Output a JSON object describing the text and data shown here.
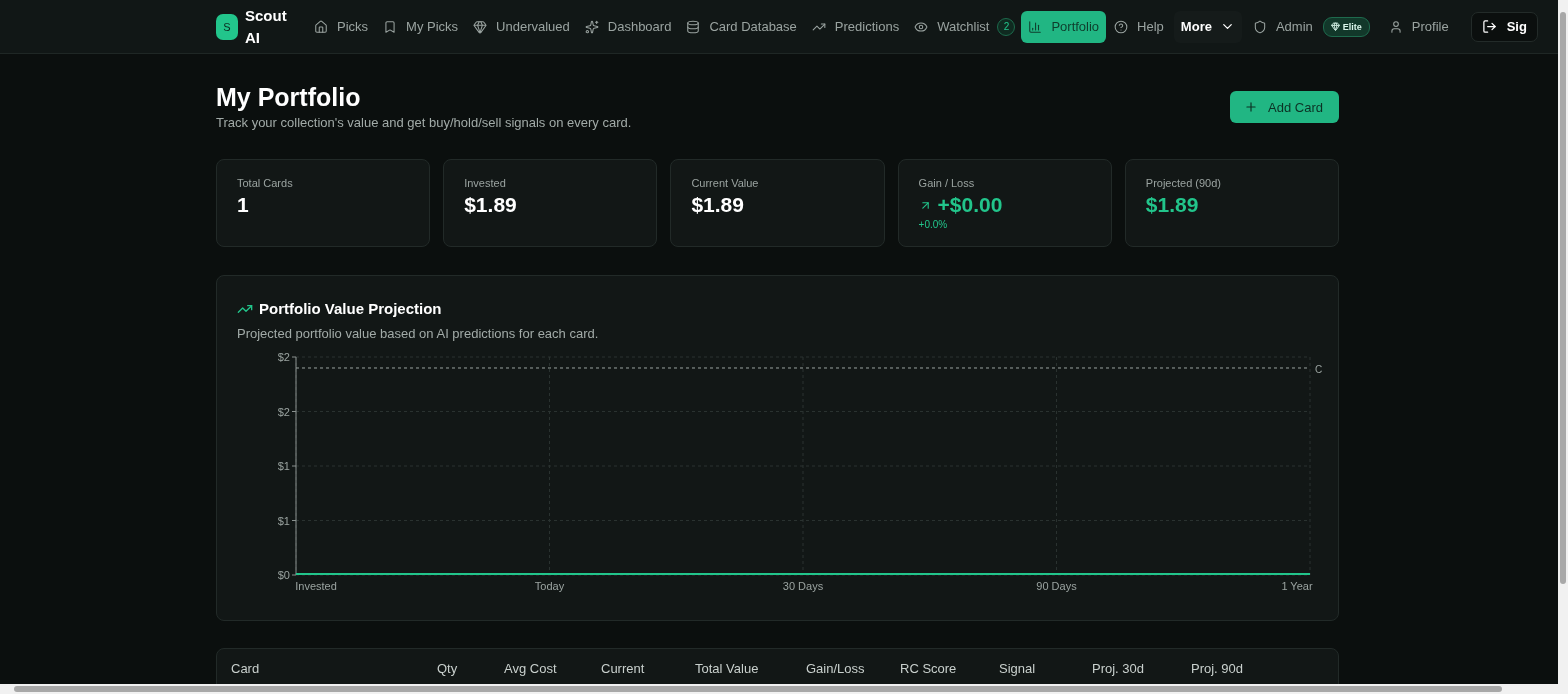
{
  "brand": {
    "mark": "S",
    "name": "Scout AI"
  },
  "nav": [
    {
      "label": "Picks",
      "selected": false
    },
    {
      "label": "My Picks",
      "selected": false
    },
    {
      "label": "Undervalued",
      "selected": false
    },
    {
      "label": "Dashboard",
      "selected": false
    },
    {
      "label": "Card Database",
      "selected": false
    },
    {
      "label": "Predictions",
      "selected": false
    },
    {
      "label": "Watchlist",
      "selected": false,
      "badge": "2"
    },
    {
      "label": "Portfolio",
      "selected": true
    },
    {
      "label": "Help",
      "selected": false
    }
  ],
  "more_menu": {
    "label": "More"
  },
  "admin": {
    "label": "Admin",
    "badge": "Elite"
  },
  "profile": {
    "label": "Profile"
  },
  "sign_out": {
    "label": "Sig"
  },
  "page": {
    "title": "My Portfolio",
    "subtitle": "Track your collection's value and get buy/hold/sell signals on every card.",
    "add_button": "Add Card"
  },
  "stats": [
    {
      "label": "Total Cards",
      "value": "1",
      "positive": false
    },
    {
      "label": "Invested",
      "value": "$1.89",
      "positive": false
    },
    {
      "label": "Current Value",
      "value": "$1.89",
      "positive": false
    },
    {
      "label": "Gain / Loss",
      "value": "+$0.00",
      "positive": true,
      "sub": "+0.0%"
    },
    {
      "label": "Projected (90d)",
      "value": "$1.89",
      "positive": true
    }
  ],
  "projection": {
    "title": "Portfolio Value Projection",
    "description": "Projected portfolio value based on AI predictions for each card.",
    "chart_data": {
      "type": "line",
      "categories": [
        "Invested",
        "Today",
        "30 Days",
        "90 Days",
        "1 Year"
      ],
      "series": [
        {
          "color": "#22c58b",
          "values": [
            0,
            0,
            0,
            0,
            0
          ]
        },
        {
          "color": "#9aa3a0",
          "line_style": "dashed",
          "values": [
            1.89,
            1.89,
            1.89,
            1.89,
            1.89
          ]
        }
      ],
      "grid": true,
      "ylim": [
        0,
        2
      ],
      "yticks": [
        {
          "value": 0,
          "label": "$0"
        },
        {
          "value": 0.5,
          "label": "$1"
        },
        {
          "value": 1,
          "label": "$1"
        },
        {
          "value": 1.5,
          "label": "$2"
        },
        {
          "value": 2,
          "label": "$2"
        }
      ],
      "annotations": [
        {
          "text": "C"
        }
      ]
    }
  },
  "table": {
    "columns": [
      "Card",
      "Qty",
      "Avg Cost",
      "Current",
      "Total Value",
      "Gain/Loss",
      "RC Score",
      "Signal",
      "Proj. 30d",
      "Proj. 90d"
    ]
  }
}
